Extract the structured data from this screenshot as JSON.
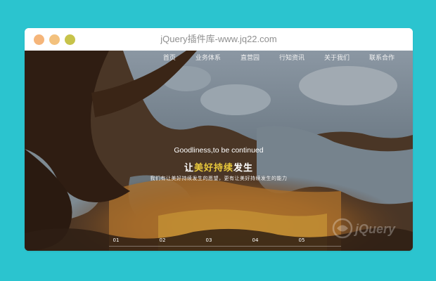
{
  "window": {
    "title": "jQuery插件库-www.jq22.com"
  },
  "nav": {
    "items": [
      "首页",
      "业务体系",
      "直营园",
      "行知资讯",
      "关于我们",
      "联系合作"
    ]
  },
  "hero": {
    "en_title": "Goodliness,to be continued",
    "cn_prefix": "让",
    "cn_highlight": "美好持续",
    "cn_suffix": "发生",
    "subtitle": "我们有让美好持续发生的愿望，更有让美好持续发生的能力"
  },
  "pager": {
    "items": [
      "01",
      "02",
      "03",
      "04",
      "05"
    ]
  },
  "watermark": {
    "text": "jQuery"
  },
  "colors": {
    "page_bg": "#2bc4cf",
    "highlight": "#e9c93c"
  }
}
